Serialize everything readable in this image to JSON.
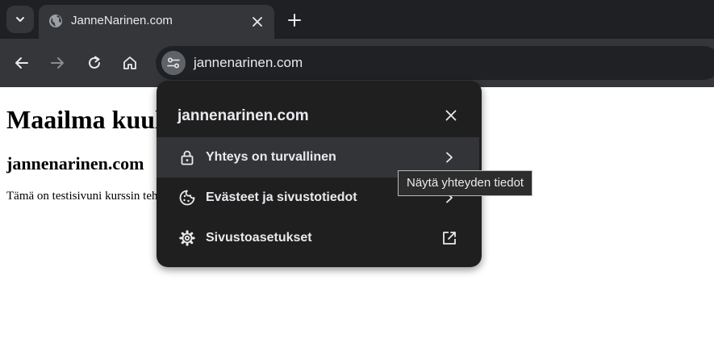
{
  "browser": {
    "tab": {
      "title": "JanneNarinen.com"
    },
    "address": {
      "url": "jannenarinen.com"
    }
  },
  "page": {
    "heading": "Maailma kuuluu",
    "subheading": "jannenarinen.com",
    "paragraph": "Tämä on testisivuni kurssin tehtävää varten."
  },
  "site_info_popup": {
    "title": "jannenarinen.com",
    "items": [
      {
        "label": "Yhteys on turvallinen",
        "icon": "lock-icon",
        "trailing": "chevron-right-icon"
      },
      {
        "label": "Evästeet ja sivustotiedot",
        "icon": "cookie-icon",
        "trailing": "chevron-right-icon"
      },
      {
        "label": "Sivustoasetukset",
        "icon": "settings-icon",
        "trailing": "open-in-new-icon"
      }
    ]
  },
  "tooltip": {
    "text": "Näytä yhteyden tiedot"
  },
  "colors": {
    "tabstrip": "#1f2023",
    "toolbar": "#35363a",
    "popup_bg": "#1f1f1f",
    "popup_hover": "#333438",
    "text_light": "#e8eaed"
  }
}
